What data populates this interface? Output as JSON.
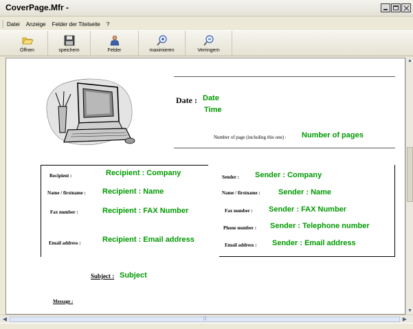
{
  "window": {
    "title": "CoverPage.Mfr -"
  },
  "menu": {
    "items": [
      "Datei",
      "Anzeige",
      "Felder der Titelseite",
      "?"
    ]
  },
  "toolbar": {
    "buttons": [
      {
        "label": "Öffnen",
        "icon": "folder-open-icon"
      },
      {
        "label": "speichern",
        "icon": "floppy-disk-icon"
      },
      {
        "label": "Felder",
        "icon": "person-fields-icon"
      },
      {
        "label": "maximieren",
        "icon": "zoom-in-icon"
      },
      {
        "label": "Verringern",
        "icon": "zoom-out-icon"
      }
    ]
  },
  "page": {
    "date_label": "Date :",
    "date_value": "Date",
    "time_value": "Time",
    "pages_label": "Number of page (including this one) :",
    "pages_value": "Number of pages",
    "recipient": {
      "company_label": "Recipient :",
      "company_value": "Recipient : Company",
      "name_label": "Name / firstname :",
      "name_value": "Recipient : Name",
      "fax_label": "Fax number :",
      "fax_value": "Recipient : FAX Number",
      "email_label": "Email address :",
      "email_value": "Recipient : Email address"
    },
    "sender": {
      "company_label": "Sender :",
      "company_value": "Sender : Company",
      "name_label": "Name / firstname :",
      "name_value": "Sender : Name",
      "fax_label": "Fax number :",
      "fax_value": "Sender : FAX Number",
      "phone_label": "Phone number :",
      "phone_value": "Sender : Telephone number",
      "email_label": "Email address :",
      "email_value": "Sender : Email address"
    },
    "subject_label": "Subject :",
    "subject_value": "Subject",
    "message_label": "Message :"
  }
}
